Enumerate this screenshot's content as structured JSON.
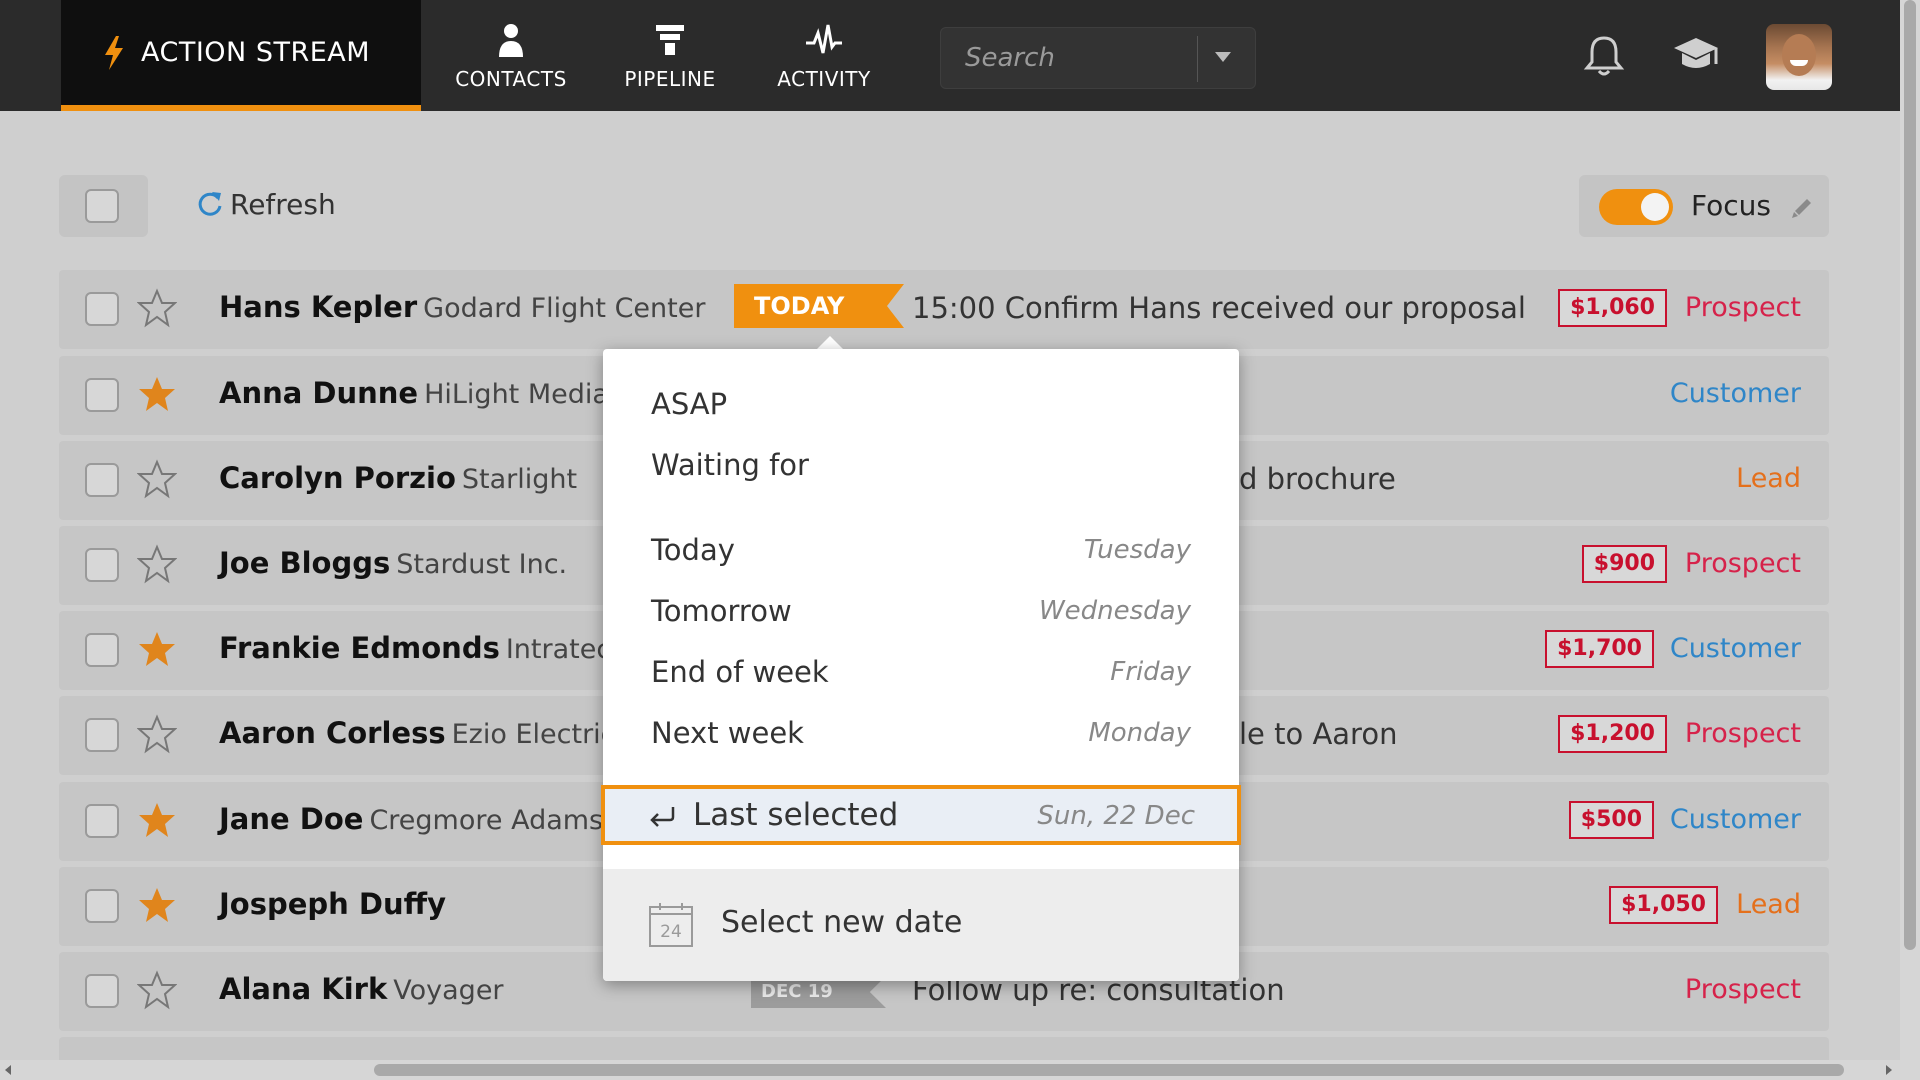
{
  "app": {
    "brand": "ACTION STREAM",
    "nav": [
      {
        "label": "CONTACTS",
        "icon": "person-icon"
      },
      {
        "label": "PIPELINE",
        "icon": "funnel-icon"
      },
      {
        "label": "ACTIVITY",
        "icon": "pulse-icon"
      }
    ],
    "search": {
      "placeholder": "Search"
    },
    "accent": "#f0900f"
  },
  "toolbar": {
    "refresh_label": "Refresh",
    "focus_label": "Focus",
    "focus_on": true
  },
  "rows": [
    {
      "name": "Hans Kepler",
      "company": "Godard Flight Center",
      "starred": false,
      "tag": "TODAY",
      "task": "15:00 Confirm Hans received our proposal",
      "amount": "$1,060",
      "status": "Prospect"
    },
    {
      "name": "Anna Dunne",
      "company": "HiLight Media",
      "starred": true,
      "tag": "",
      "task": "",
      "amount": "",
      "status": "Customer"
    },
    {
      "name": "Carolyn Porzio",
      "company": "Starlight",
      "starred": false,
      "tag": "",
      "task": "d brochure",
      "amount": "",
      "status": "Lead"
    },
    {
      "name": "Joe Bloggs",
      "company": "Stardust Inc.",
      "starred": false,
      "tag": "",
      "task": "",
      "amount": "$900",
      "status": "Prospect"
    },
    {
      "name": "Frankie Edmonds",
      "company": "Intratech",
      "starred": true,
      "tag": "",
      "task": "",
      "amount": "$1,700",
      "status": "Customer"
    },
    {
      "name": "Aaron Corless",
      "company": "Ezio Electrics",
      "starred": false,
      "tag": "",
      "task": "le to Aaron",
      "amount": "$1,200",
      "status": "Prospect"
    },
    {
      "name": "Jane Doe",
      "company": "Cregmore Adams Inc",
      "starred": true,
      "tag": "",
      "task": "",
      "amount": "$500",
      "status": "Customer"
    },
    {
      "name": "Jospeph Duffy",
      "company": "",
      "starred": true,
      "tag": "",
      "task": "",
      "amount": "$1,050",
      "status": "Lead"
    },
    {
      "name": "Alana Kirk",
      "company": "Voyager",
      "starred": false,
      "tag": "DEC 19",
      "task": "Follow up re: consultation",
      "amount": "",
      "status": "Prospect"
    }
  ],
  "popover": {
    "items": [
      {
        "label": "ASAP",
        "hint": ""
      },
      {
        "label": "Waiting for",
        "hint": ""
      },
      {
        "label": "Today",
        "hint": "Tuesday"
      },
      {
        "label": "Tomorrow",
        "hint": "Wednesday"
      },
      {
        "label": "End of week",
        "hint": "Friday"
      },
      {
        "label": "Next week",
        "hint": "Monday"
      }
    ],
    "last_selected": {
      "label": "Last selected",
      "hint": "Sun, 22 Dec"
    },
    "new_date": {
      "label": "Select new date",
      "calendar_day": "24"
    }
  }
}
